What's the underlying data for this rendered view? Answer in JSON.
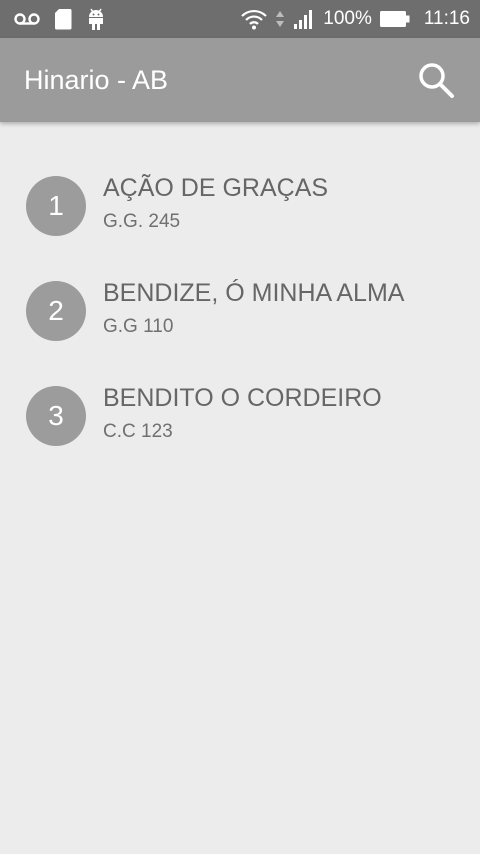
{
  "status_bar": {
    "battery_percent": "100%",
    "time": "11:16",
    "icons": [
      "voicemail-icon",
      "sd-card-icon",
      "android-icon",
      "wifi-icon",
      "data-arrows-icon",
      "signal-icon",
      "battery-icon"
    ]
  },
  "app_bar": {
    "title": "Hinario - AB",
    "action_icon": "search-icon"
  },
  "hymns": [
    {
      "number": "1",
      "title": "AÇÃO DE GRAÇAS",
      "subtitle": "G.G. 245"
    },
    {
      "number": "2",
      "title": "BENDIZE, Ó MINHA ALMA",
      "subtitle": "G.G 110"
    },
    {
      "number": "3",
      "title": "BENDITO O CORDEIRO",
      "subtitle": "C.C 123"
    }
  ],
  "colors": {
    "status_bar": "#6e6e6e",
    "app_bar": "#9b9b9b",
    "background": "#ececec",
    "badge": "#9c9c9c",
    "title_text": "#666666"
  }
}
